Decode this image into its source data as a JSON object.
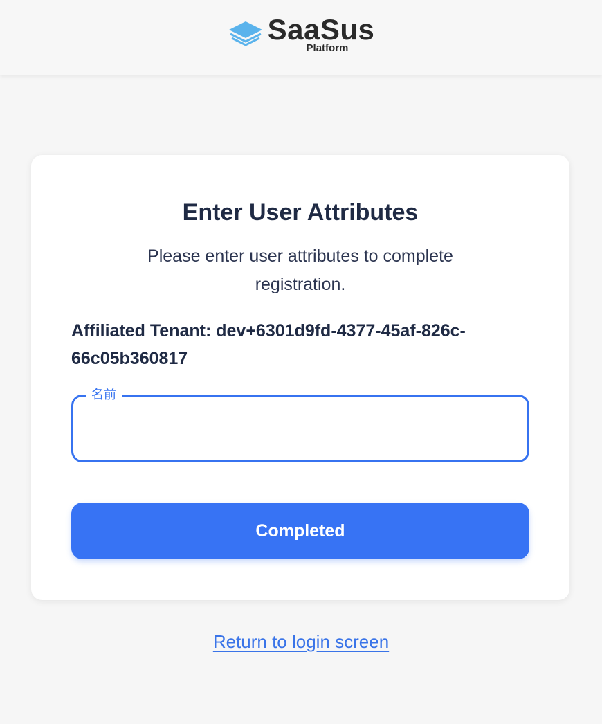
{
  "header": {
    "brand": "SaaSus",
    "brand_sub": "Platform",
    "logo_icon": "stacked-layers-icon",
    "logo_color": "#5ab3ec"
  },
  "card": {
    "title": "Enter User Attributes",
    "subtitle": "Please enter user attributes to complete registration.",
    "tenant_text": "Affiliated Tenant: dev+6301d9fd-4377-45af-826c-66c05b360817",
    "name_field": {
      "label": "名前",
      "value": "",
      "placeholder": ""
    },
    "submit_label": "Completed"
  },
  "footer": {
    "return_link": "Return to login screen"
  },
  "colors": {
    "accent": "#3773f4",
    "text": "#1f2a44",
    "background": "#f6f6f6"
  }
}
